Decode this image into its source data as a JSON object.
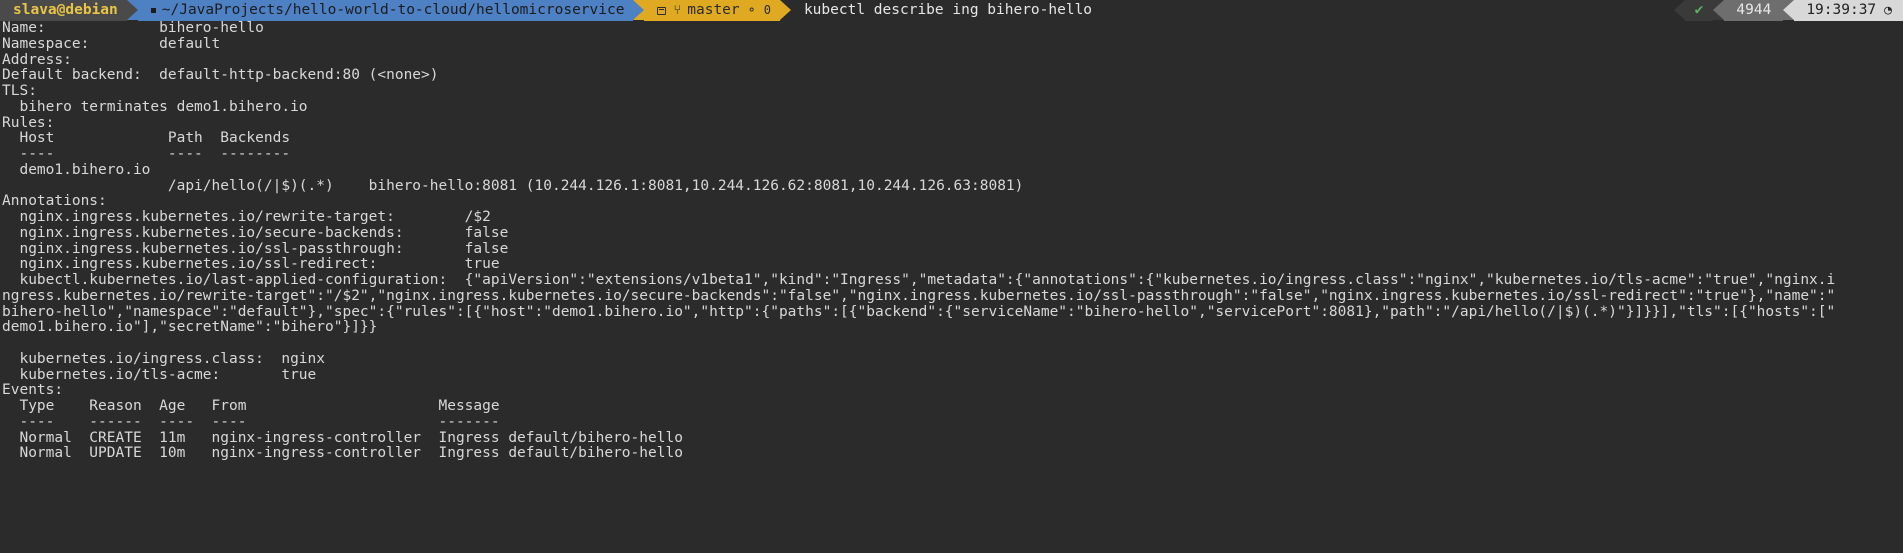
{
  "prompt": {
    "user": "slava@debian",
    "path": "~/JavaProjects/hello-world-to-cloud/hellomicroservice",
    "branch": "master",
    "branch_icon": "git-branch-icon",
    "git_status_a": "0",
    "git_status_b": "0",
    "terminal_icon": "terminal-icon",
    "command": "kubectl describe ing bihero-hello"
  },
  "status": {
    "exit_ok_icon": "checkmark-icon",
    "exit_ok": "✔",
    "job_number": "4944",
    "time": "19:39:37",
    "clock_icon": "clock-icon",
    "clock_glyph": "◔"
  },
  "colors": {
    "background": "#2b2b2b",
    "foreground": "#d8d8d8",
    "user_segment": "#4a4a4a",
    "user_text": "#e8c547",
    "path_segment": "#4e80c4",
    "git_segment": "#dfaa22",
    "status_ok": "#5faf5f",
    "status_num_bg": "#6e6e6e",
    "status_clock_bg": "#d8d8d8"
  },
  "output": {
    "lines": [
      "Name:             bihero-hello",
      "Namespace:        default",
      "Address:",
      "Default backend:  default-http-backend:80 (<none>)",
      "TLS:",
      "  bihero terminates demo1.bihero.io",
      "Rules:",
      "  Host             Path  Backends",
      "  ----             ----  --------",
      "  demo1.bihero.io",
      "                   /api/hello(/|$)(.*)    bihero-hello:8081 (10.244.126.1:8081,10.244.126.62:8081,10.244.126.63:8081)",
      "Annotations:",
      "  nginx.ingress.kubernetes.io/rewrite-target:        /$2",
      "  nginx.ingress.kubernetes.io/secure-backends:       false",
      "  nginx.ingress.kubernetes.io/ssl-passthrough:       false",
      "  nginx.ingress.kubernetes.io/ssl-redirect:          true",
      "  kubectl.kubernetes.io/last-applied-configuration:  {\"apiVersion\":\"extensions/v1beta1\",\"kind\":\"Ingress\",\"metadata\":{\"annotations\":{\"kubernetes.io/ingress.class\":\"nginx\",\"kubernetes.io/tls-acme\":\"true\",\"nginx.i",
      "ngress.kubernetes.io/rewrite-target\":\"/$2\",\"nginx.ingress.kubernetes.io/secure-backends\":\"false\",\"nginx.ingress.kubernetes.io/ssl-passthrough\":\"false\",\"nginx.ingress.kubernetes.io/ssl-redirect\":\"true\"},\"name\":\"",
      "bihero-hello\",\"namespace\":\"default\"},\"spec\":{\"rules\":[{\"host\":\"demo1.bihero.io\",\"http\":{\"paths\":[{\"backend\":{\"serviceName\":\"bihero-hello\",\"servicePort\":8081},\"path\":\"/api/hello(/|$)(.*)\"}]}}],\"tls\":[{\"hosts\":[\"",
      "demo1.bihero.io\"],\"secretName\":\"bihero\"}]}}",
      "",
      "  kubernetes.io/ingress.class:  nginx",
      "  kubernetes.io/tls-acme:       true",
      "Events:",
      "  Type    Reason  Age   From                      Message",
      "  ----    ------  ----  ----                      -------",
      "  Normal  CREATE  11m   nginx-ingress-controller  Ingress default/bihero-hello",
      "  Normal  UPDATE  10m   nginx-ingress-controller  Ingress default/bihero-hello"
    ]
  }
}
